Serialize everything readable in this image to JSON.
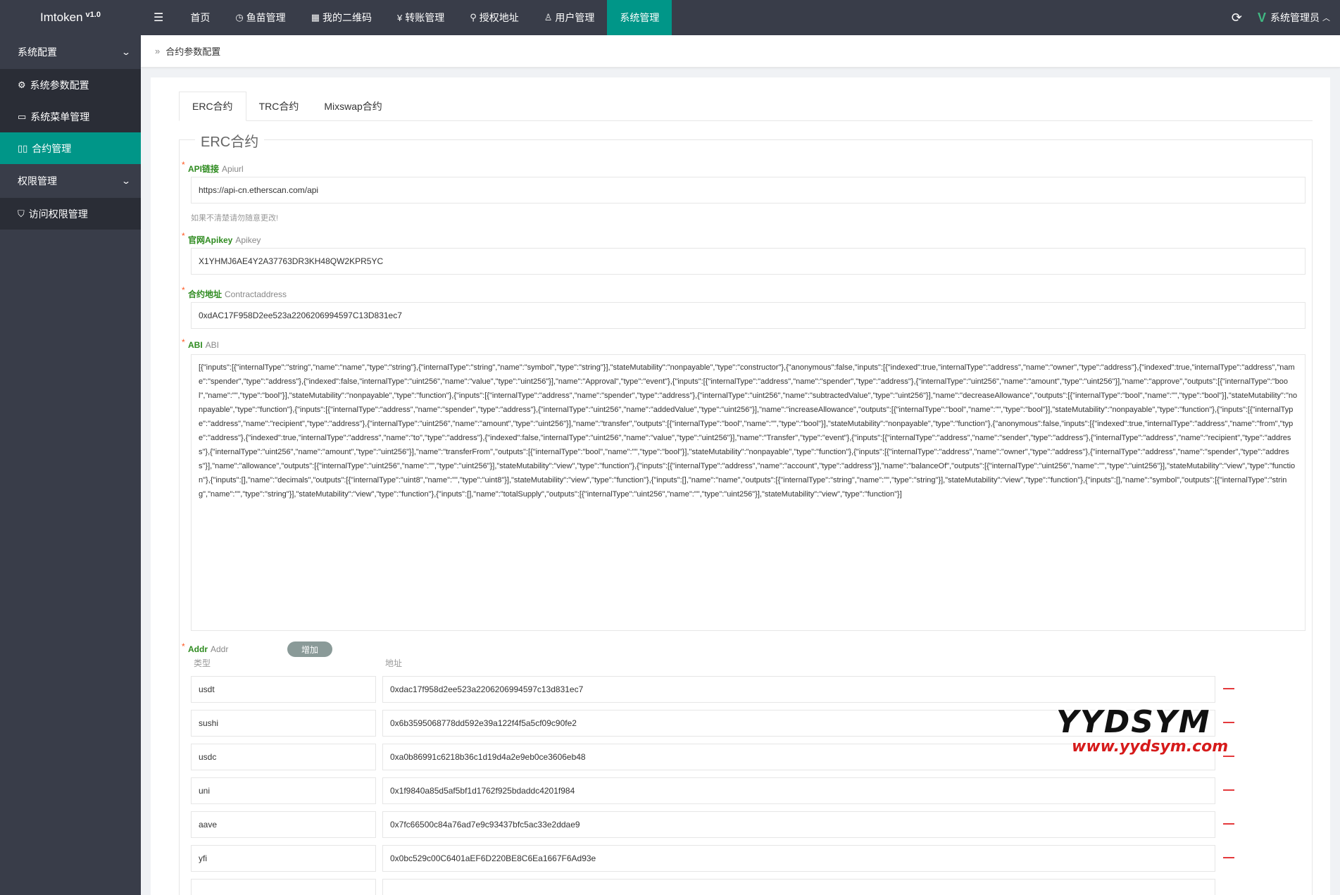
{
  "app": {
    "title": "Imtoken",
    "version": "v1.0"
  },
  "nav": {
    "toggle_icon": "menu-toggle-icon",
    "items": [
      {
        "label": "首页",
        "icon": ""
      },
      {
        "label": "鱼苗管理",
        "icon": "clock-icon"
      },
      {
        "label": "我的二维码",
        "icon": "qrcode-icon"
      },
      {
        "label": "转账管理",
        "icon": "yen-icon"
      },
      {
        "label": "授权地址",
        "icon": "pin-icon"
      },
      {
        "label": "用户管理",
        "icon": "user-icon"
      },
      {
        "label": "系统管理",
        "icon": "",
        "active": true
      }
    ]
  },
  "user": {
    "name": "系统管理员"
  },
  "sidebar": {
    "groups": [
      {
        "label": "系统配置",
        "items": [
          {
            "label": "系统参数配置",
            "icon": "gear-icon"
          },
          {
            "label": "系统菜单管理",
            "icon": "window-icon"
          },
          {
            "label": "合约管理",
            "icon": "columns-icon",
            "active": true
          }
        ]
      },
      {
        "label": "权限管理",
        "items": [
          {
            "label": "访问权限管理",
            "icon": "shield-icon"
          }
        ]
      }
    ]
  },
  "breadcrumb": {
    "current": "合约参数配置"
  },
  "tabs": [
    "ERC合约",
    "TRC合约",
    "Mixswap合约"
  ],
  "form": {
    "legend": "ERC合约",
    "api": {
      "label": "API链接",
      "sub": "Apiurl",
      "value": "https://api-cn.etherscan.com/api",
      "hint": "如果不清楚请勿随意更改!"
    },
    "apikey": {
      "label": "官网Apikey",
      "sub": "Apikey",
      "value": "X1YHMJ6AE4Y2A37763DR3KH48QW2KPR5YC"
    },
    "contract": {
      "label": "合约地址",
      "sub": "Contractaddress",
      "value": "0xdAC17F958D2ee523a2206206994597C13D831ec7"
    },
    "abi": {
      "label": "ABI",
      "sub": "ABI",
      "value": "[{\"inputs\":[{\"internalType\":\"string\",\"name\":\"name\",\"type\":\"string\"},{\"internalType\":\"string\",\"name\":\"symbol\",\"type\":\"string\"}],\"stateMutability\":\"nonpayable\",\"type\":\"constructor\"},{\"anonymous\":false,\"inputs\":[{\"indexed\":true,\"internalType\":\"address\",\"name\":\"owner\",\"type\":\"address\"},{\"indexed\":true,\"internalType\":\"address\",\"name\":\"spender\",\"type\":\"address\"},{\"indexed\":false,\"internalType\":\"uint256\",\"name\":\"value\",\"type\":\"uint256\"}],\"name\":\"Approval\",\"type\":\"event\"},{\"inputs\":[{\"internalType\":\"address\",\"name\":\"spender\",\"type\":\"address\"},{\"internalType\":\"uint256\",\"name\":\"amount\",\"type\":\"uint256\"}],\"name\":\"approve\",\"outputs\":[{\"internalType\":\"bool\",\"name\":\"\",\"type\":\"bool\"}],\"stateMutability\":\"nonpayable\",\"type\":\"function\"},{\"inputs\":[{\"internalType\":\"address\",\"name\":\"spender\",\"type\":\"address\"},{\"internalType\":\"uint256\",\"name\":\"subtractedValue\",\"type\":\"uint256\"}],\"name\":\"decreaseAllowance\",\"outputs\":[{\"internalType\":\"bool\",\"name\":\"\",\"type\":\"bool\"}],\"stateMutability\":\"nonpayable\",\"type\":\"function\"},{\"inputs\":[{\"internalType\":\"address\",\"name\":\"spender\",\"type\":\"address\"},{\"internalType\":\"uint256\",\"name\":\"addedValue\",\"type\":\"uint256\"}],\"name\":\"increaseAllowance\",\"outputs\":[{\"internalType\":\"bool\",\"name\":\"\",\"type\":\"bool\"}],\"stateMutability\":\"nonpayable\",\"type\":\"function\"},{\"inputs\":[{\"internalType\":\"address\",\"name\":\"recipient\",\"type\":\"address\"},{\"internalType\":\"uint256\",\"name\":\"amount\",\"type\":\"uint256\"}],\"name\":\"transfer\",\"outputs\":[{\"internalType\":\"bool\",\"name\":\"\",\"type\":\"bool\"}],\"stateMutability\":\"nonpayable\",\"type\":\"function\"},{\"anonymous\":false,\"inputs\":[{\"indexed\":true,\"internalType\":\"address\",\"name\":\"from\",\"type\":\"address\"},{\"indexed\":true,\"internalType\":\"address\",\"name\":\"to\",\"type\":\"address\"},{\"indexed\":false,\"internalType\":\"uint256\",\"name\":\"value\",\"type\":\"uint256\"}],\"name\":\"Transfer\",\"type\":\"event\"},{\"inputs\":[{\"internalType\":\"address\",\"name\":\"sender\",\"type\":\"address\"},{\"internalType\":\"address\",\"name\":\"recipient\",\"type\":\"address\"},{\"internalType\":\"uint256\",\"name\":\"amount\",\"type\":\"uint256\"}],\"name\":\"transferFrom\",\"outputs\":[{\"internalType\":\"bool\",\"name\":\"\",\"type\":\"bool\"}],\"stateMutability\":\"nonpayable\",\"type\":\"function\"},{\"inputs\":[{\"internalType\":\"address\",\"name\":\"owner\",\"type\":\"address\"},{\"internalType\":\"address\",\"name\":\"spender\",\"type\":\"address\"}],\"name\":\"allowance\",\"outputs\":[{\"internalType\":\"uint256\",\"name\":\"\",\"type\":\"uint256\"}],\"stateMutability\":\"view\",\"type\":\"function\"},{\"inputs\":[{\"internalType\":\"address\",\"name\":\"account\",\"type\":\"address\"}],\"name\":\"balanceOf\",\"outputs\":[{\"internalType\":\"uint256\",\"name\":\"\",\"type\":\"uint256\"}],\"stateMutability\":\"view\",\"type\":\"function\"},{\"inputs\":[],\"name\":\"decimals\",\"outputs\":[{\"internalType\":\"uint8\",\"name\":\"\",\"type\":\"uint8\"}],\"stateMutability\":\"view\",\"type\":\"function\"},{\"inputs\":[],\"name\":\"name\",\"outputs\":[{\"internalType\":\"string\",\"name\":\"\",\"type\":\"string\"}],\"stateMutability\":\"view\",\"type\":\"function\"},{\"inputs\":[],\"name\":\"symbol\",\"outputs\":[{\"internalType\":\"string\",\"name\":\"\",\"type\":\"string\"}],\"stateMutability\":\"view\",\"type\":\"function\"},{\"inputs\":[],\"name\":\"totalSupply\",\"outputs\":[{\"internalType\":\"uint256\",\"name\":\"\",\"type\":\"uint256\"}],\"stateMutability\":\"view\",\"type\":\"function\"}]"
    },
    "addr": {
      "label": "Addr",
      "sub": "Addr",
      "add_button": "增加",
      "col_type": "类型",
      "col_address": "地址",
      "rows": [
        {
          "type": "usdt",
          "address": "0xdac17f958d2ee523a2206206994597c13d831ec7"
        },
        {
          "type": "sushi",
          "address": "0x6b3595068778dd592e39a122f4f5a5cf09c90fe2"
        },
        {
          "type": "usdc",
          "address": "0xa0b86991c6218b36c1d19d4a2e9eb0ce3606eb48"
        },
        {
          "type": "uni",
          "address": "0x1f9840a85d5af5bf1d1762f925bdaddc4201f984"
        },
        {
          "type": "aave",
          "address": "0x7fc66500c84a76ad7e9c93437bfc5ac33e2ddae9"
        },
        {
          "type": "yfi",
          "address": "0x0bc529c00C6401aEF6D220BE8C6Ea1667F6Ad93e"
        }
      ]
    }
  },
  "watermark": {
    "line1": "YYDSYM",
    "line2": "www.yydsym.com"
  }
}
